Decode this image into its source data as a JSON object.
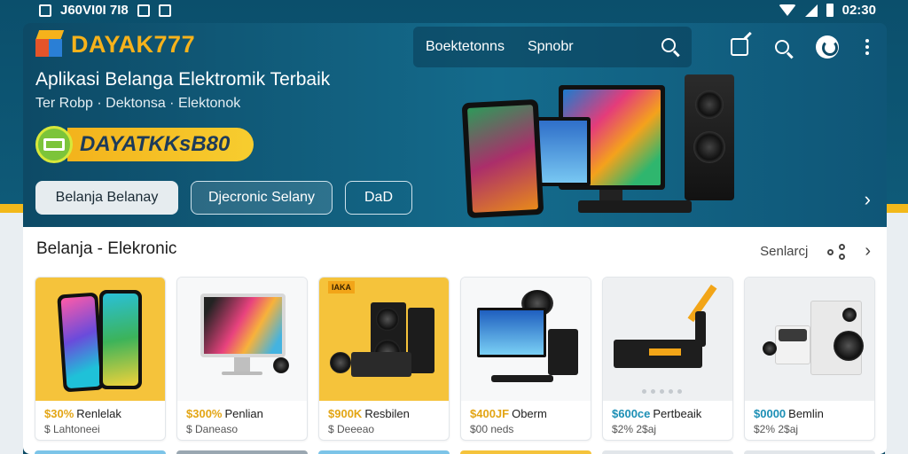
{
  "status_bar": {
    "left_text": "J60VI0I 7I8",
    "time": "02:30"
  },
  "app": {
    "brand": "DAYAK777",
    "nav": {
      "links": [
        "Boektetonns",
        "Spnobr"
      ]
    },
    "hero": {
      "headline": "Aplikasi Belanga Elektromik Terbaik",
      "subline": "Ter Robp  ·  Dektonsa  ·  Elektonok",
      "promo_text": "DAYATKKsB80",
      "buttons": {
        "primary": "Belanja Belanay",
        "secondary": "Djecronic Selany",
        "tertiary": "DaD"
      }
    },
    "section": {
      "title": "Belanja - Elekronic",
      "action_label": "Senlarcj"
    },
    "products": [
      {
        "price": "$30%",
        "name": "Renlelak",
        "sub": "$ Lahtoneei",
        "tag": ""
      },
      {
        "price": "$300%",
        "name": "Penlian",
        "sub": "$ Daneaso",
        "tag": ""
      },
      {
        "price": "$900K",
        "name": "Resbilen",
        "sub": "$ Deeeao",
        "tag": "IAKA"
      },
      {
        "price": "$400JF",
        "name": "Oberm",
        "sub": "$00 neds",
        "tag": ""
      },
      {
        "price": "$600ce",
        "name": "Pertbeaik",
        "sub": "$2% 2$aj",
        "tag": ""
      },
      {
        "price": "$0000",
        "name": "Bemlin",
        "sub": "$2% 2$aj",
        "tag": ""
      }
    ]
  },
  "colors": {
    "accent": "#f6b21b",
    "hero_bg": "#0d4a66",
    "price": "#e3a514"
  },
  "icons": [
    "wifi-icon",
    "signal-icon",
    "battery-icon",
    "search-icon",
    "edit-icon",
    "profile-icon",
    "more-icon",
    "share-icon",
    "chevron-right-icon"
  ]
}
